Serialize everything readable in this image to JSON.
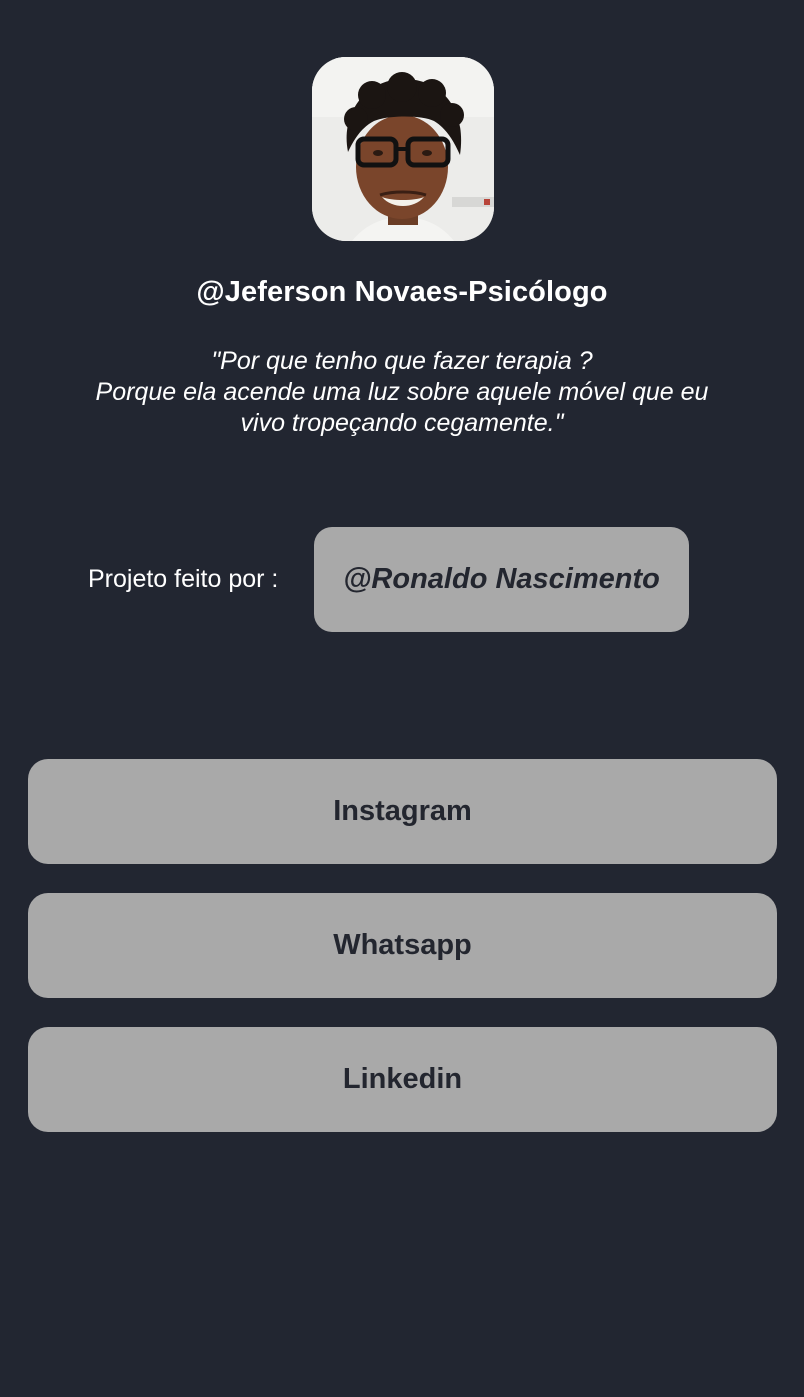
{
  "profile": {
    "avatar_alt": "Jeferson Novaes",
    "username": "@Jeferson Novaes-Psicólogo",
    "quote_lines": [
      "\"Por que tenho que fazer terapia ?",
      "Porque ela acende uma luz sobre aquele móvel que eu",
      "vivo tropeçando cegamente.\""
    ]
  },
  "credit": {
    "label": "Projeto feito por :",
    "author": "@Ronaldo Nascimento"
  },
  "links": [
    {
      "label": "Instagram"
    },
    {
      "label": "Whatsapp"
    },
    {
      "label": "Linkedin"
    }
  ],
  "colors": {
    "background": "#222631",
    "button": "#a9a9a9",
    "button_text": "#23262f",
    "text": "#ffffff"
  }
}
